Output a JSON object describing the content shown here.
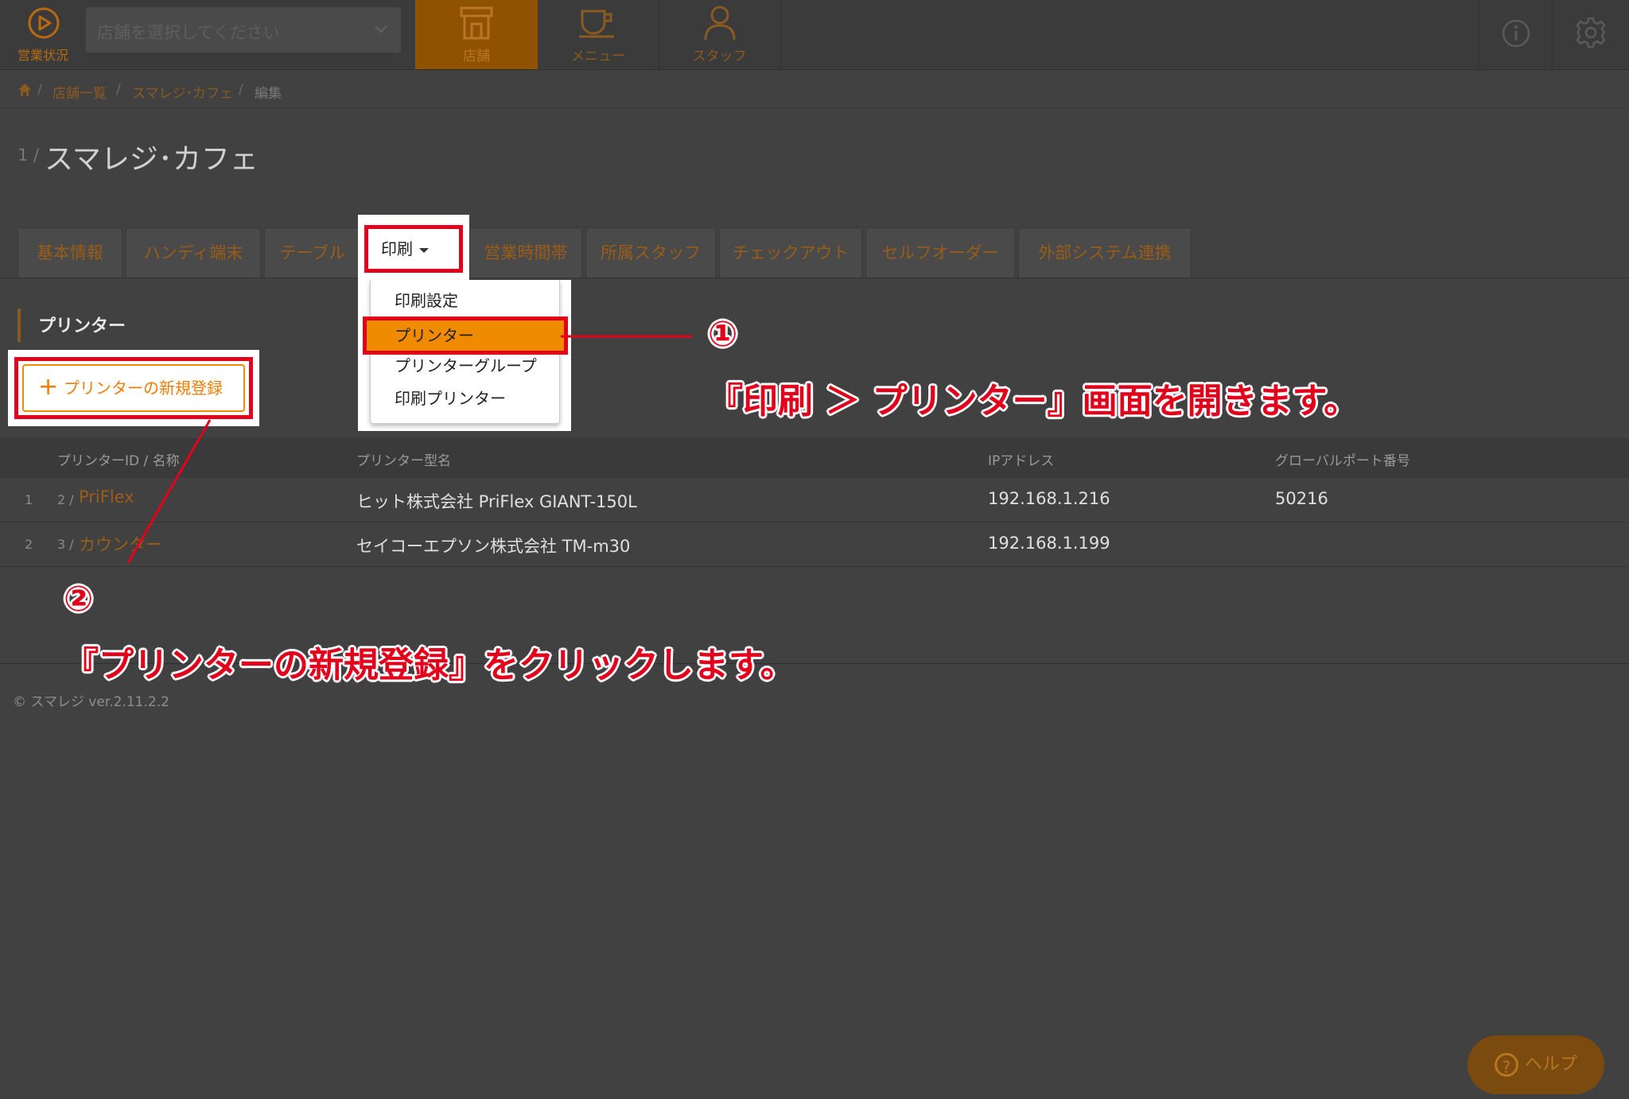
{
  "topbar": {
    "status_label": "営業状況",
    "store_select_placeholder": "店舗を選択してください",
    "nav": [
      {
        "label": "店舗",
        "icon": "store-icon"
      },
      {
        "label": "メニュー",
        "icon": "menu-cup-icon"
      },
      {
        "label": "スタッフ",
        "icon": "staff-icon"
      }
    ]
  },
  "breadcrumb": {
    "items": [
      "店舗一覧",
      "スマレジ･カフェ",
      "編集"
    ],
    "separator": "/"
  },
  "page": {
    "store_no": "1 /",
    "store_name": "スマレジ･カフェ"
  },
  "tabs": [
    "基本情報",
    "ハンディ端末",
    "テーブル",
    "印刷",
    "営業時間帯",
    "所属スタッフ",
    "チェックアウト",
    "セルフオーダー",
    "外部システム連携"
  ],
  "dropdown": {
    "items": [
      "印刷設定",
      "プリンター",
      "プリンターグループ",
      "印刷プリンター"
    ],
    "selected": "プリンター"
  },
  "section": {
    "title": "プリンター",
    "new_button": "プリンターの新規登録"
  },
  "table": {
    "headers": [
      "プリンターID / 名称",
      "プリンター型名",
      "IPアドレス",
      "グローバルポート番号"
    ],
    "rows": [
      {
        "no": "1",
        "id": "2 /",
        "name": "PriFlex",
        "model": "ヒット株式会社 PriFlex GIANT-150L",
        "ip": "192.168.1.216",
        "port": "50216"
      },
      {
        "no": "2",
        "id": "3 /",
        "name": "カウンター",
        "model": "セイコーエプソン株式会社 TM-m30",
        "ip": "192.168.1.199",
        "port": ""
      }
    ]
  },
  "footer": "© スマレジ ver.2.11.2.2",
  "annotations": {
    "step1_mark": "①",
    "step1_text": "『印刷 ＞ プリンター』画面を開きます。",
    "step2_mark": "②",
    "step2_text": "『プリンターの新規登録』をクリックします。"
  },
  "help": "ヘルプ",
  "colors": {
    "accent": "#f08b00",
    "annotation": "#e3001b",
    "background": "#414141"
  }
}
